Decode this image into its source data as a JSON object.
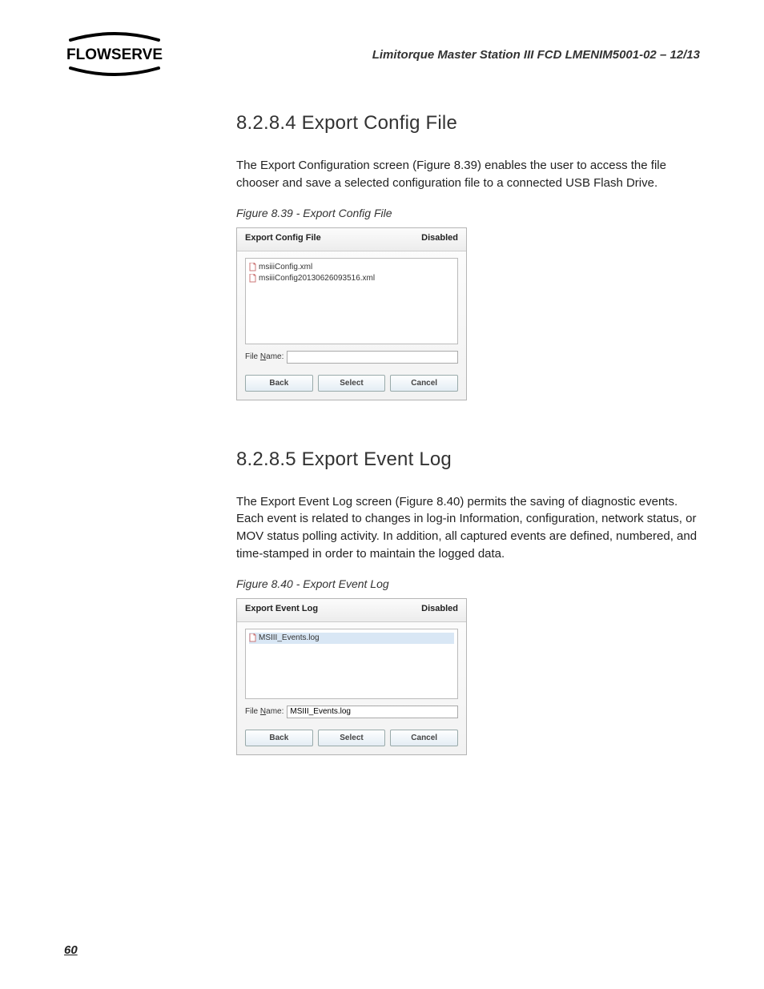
{
  "header": {
    "doc_title": "Limitorque Master Station III   FCD LMENIM5001-02 – 12/13",
    "logo_text": "FLOWSERVE"
  },
  "section1": {
    "heading": "8.2.8.4 Export Config File",
    "body": "The Export Configuration screen (Figure 8.39) enables the user to access the file chooser and save a selected configuration file to a connected USB Flash Drive.",
    "fig_caption": "Figure 8.39 - Export Config File",
    "dialog": {
      "title": "Export Config File",
      "status": "Disabled",
      "files": [
        "msiiiConfig.xml",
        "msiiiConfig20130626093516.xml"
      ],
      "file_name_label_pre": "File ",
      "file_name_label_u": "N",
      "file_name_label_post": "ame:",
      "file_name_value": "",
      "buttons": {
        "back": "Back",
        "select": "Select",
        "cancel": "Cancel"
      }
    }
  },
  "section2": {
    "heading": "8.2.8.5 Export Event Log",
    "body": "The Export Event Log screen (Figure 8.40) permits the saving of diagnostic events. Each event is related to changes in log-in Information, configuration, network status, or MOV status polling activity. In addition, all captured events are defined, numbered, and time-stamped in order to maintain the logged data.",
    "fig_caption": "Figure 8.40 - Export Event Log",
    "dialog": {
      "title": "Export Event Log",
      "status": "Disabled",
      "files": [
        "MSIII_Events.log"
      ],
      "file_name_label_pre": "File ",
      "file_name_label_u": "N",
      "file_name_label_post": "ame:",
      "file_name_value": "MSIII_Events.log",
      "buttons": {
        "back": "Back",
        "select": "Select",
        "cancel": "Cancel"
      }
    }
  },
  "page_number": "60"
}
